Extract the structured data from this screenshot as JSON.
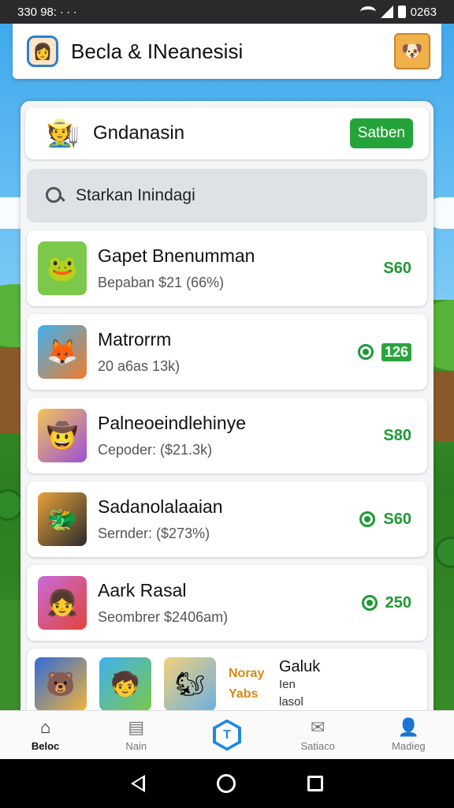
{
  "status_bar": {
    "time_left": "330 98:",
    "signals_left": "∙ ∙ ∙",
    "time_right": "0263"
  },
  "header": {
    "title": "Becla & INeanesisi"
  },
  "profile": {
    "name": "Gndanasin",
    "button_label": "Satben"
  },
  "search": {
    "placeholder": "Starkan Inindagi"
  },
  "items": [
    {
      "title": "Gapet Bnenumman",
      "subtitle": "Bepaban $21 (66%)",
      "price": "S60",
      "has_icon": false,
      "badge": false
    },
    {
      "title": "Matrorrm",
      "subtitle": "20 a6as    13k)",
      "price": "126",
      "has_icon": true,
      "badge": true
    },
    {
      "title": "Palneoeindlehinye",
      "subtitle": "Cepoder: ($21.3k)",
      "price": "S80",
      "has_icon": false,
      "badge": false
    },
    {
      "title": "Sadanolalaaian",
      "subtitle": "Sernder: ($273%)",
      "price": "S60",
      "has_icon": true,
      "badge": false
    },
    {
      "title": "Aark Rasal",
      "subtitle": "Seombrer $2406am)",
      "price": "250",
      "has_icon": true,
      "badge": false
    }
  ],
  "promo": {
    "logo_top": "Noray",
    "logo_bottom": "Yabs",
    "title": "Galuk",
    "line1": "Ien",
    "line2": "lasol"
  },
  "nav": [
    {
      "label": "Beloc",
      "icon": "home-icon"
    },
    {
      "label": "Nain",
      "icon": "inbox-icon"
    },
    {
      "label": "",
      "icon": "hexagon-t-icon"
    },
    {
      "label": "Satiaco",
      "icon": "mail-icon"
    },
    {
      "label": "Madieg",
      "icon": "person-icon"
    }
  ],
  "center_nav_glyph": "T",
  "colors": {
    "accent_green": "#1e9a33",
    "nav_blue": "#1e88e5"
  }
}
